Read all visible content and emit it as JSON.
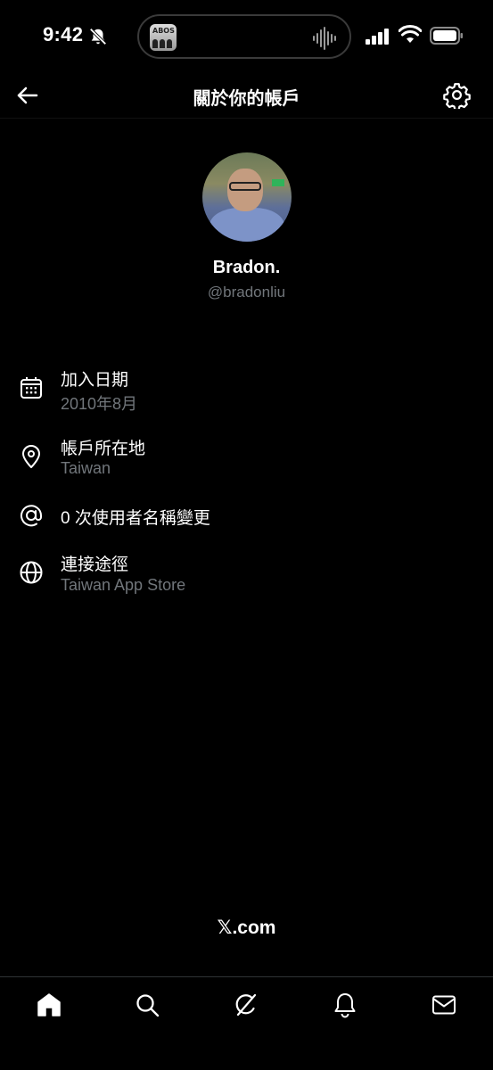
{
  "status_bar": {
    "time": "9:42"
  },
  "header": {
    "title": "關於你的帳戶"
  },
  "profile": {
    "display_name": "Bradon.",
    "handle": "@bradonliu"
  },
  "info": {
    "joined": {
      "label": "加入日期",
      "value": "2010年8月"
    },
    "location": {
      "label": "帳戶所在地",
      "value": "Taiwan"
    },
    "username_changes": {
      "label": "0 次使用者名稱變更"
    },
    "connected_via": {
      "label": "連接途徑",
      "value": "Taiwan App Store"
    }
  },
  "footer": {
    "brand": "𝕏.com"
  },
  "island": {
    "art_text": "ABOS"
  },
  "icons": {
    "back": "arrow-left-icon",
    "settings": "gear-icon",
    "joined": "calendar-icon",
    "location": "location-pin-icon",
    "username": "at-sign-icon",
    "connected": "globe-icon",
    "tabs": [
      "home-icon",
      "search-icon",
      "grok-icon",
      "bell-icon",
      "mail-icon"
    ]
  },
  "colors": {
    "background": "#000000",
    "primary_text": "#e7e9ea",
    "secondary_text": "#71767b"
  }
}
